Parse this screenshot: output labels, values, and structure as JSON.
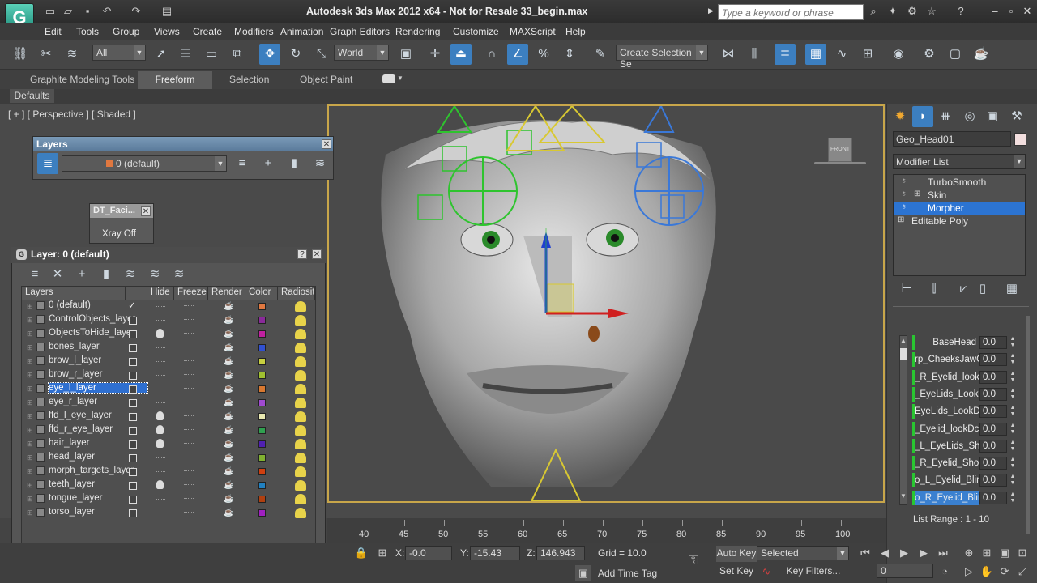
{
  "window": {
    "title": "Autodesk 3ds Max  2012 x64  - Not for Resale   33_begin.max",
    "search_placeholder": "Type a keyword or phrase",
    "logo_letter": "G"
  },
  "menu": [
    "Edit",
    "Tools",
    "Group",
    "Views",
    "Create",
    "Modifiers",
    "Animation",
    "Graph Editors",
    "Rendering",
    "Customize",
    "MAXScript",
    "Help"
  ],
  "toolbar": {
    "filter_value": "All",
    "coord_value": "World",
    "selection_set_placeholder": "Create Selection Se"
  },
  "ribbon": {
    "tabs": [
      "Graphite Modeling Tools",
      "Freeform",
      "Selection",
      "Object Paint"
    ],
    "active_tab": "Freeform",
    "defaults_label": "Defaults"
  },
  "viewport": {
    "label": "[ + ] [ Perspective ] [ Shaded ]",
    "viewcube_label": "FRONT"
  },
  "layers_toolbar": {
    "title": "Layers",
    "current_layer": "0 (default)"
  },
  "dt_facial": {
    "title": "DT_Faci...",
    "button": "Xray Off"
  },
  "layer_dialog": {
    "title": "Layer: 0 (default)",
    "columns": [
      "Layers",
      "Hide",
      "Freeze",
      "Render",
      "Color",
      "Radiosit"
    ],
    "rows": [
      {
        "name": "0 (default)",
        "current": true,
        "hide_bulb": false,
        "color": "#e07840"
      },
      {
        "name": "ControlObjects_layer",
        "current": false,
        "hide_bulb": false,
        "color": "#8a2a9a"
      },
      {
        "name": "ObjectsToHide_layer",
        "current": false,
        "hide_bulb": true,
        "color": "#c020a0"
      },
      {
        "name": "bones_layer",
        "current": false,
        "hide_bulb": false,
        "color": "#3050d0"
      },
      {
        "name": "brow_l_layer",
        "current": false,
        "hide_bulb": false,
        "color": "#c8d040"
      },
      {
        "name": "brow_r_layer",
        "current": false,
        "hide_bulb": false,
        "color": "#a0c030"
      },
      {
        "name": "eye_l_layer",
        "current": false,
        "hide_bulb": false,
        "color": "#d87830",
        "selected": true
      },
      {
        "name": "eye_r_layer",
        "current": false,
        "hide_bulb": false,
        "color": "#a04ad0"
      },
      {
        "name": "ffd_l_eye_layer",
        "current": false,
        "hide_bulb": true,
        "color": "#e8e8b0"
      },
      {
        "name": "ffd_r_eye_layer",
        "current": false,
        "hide_bulb": true,
        "color": "#30a050"
      },
      {
        "name": "hair_layer",
        "current": false,
        "hide_bulb": true,
        "color": "#5020b0"
      },
      {
        "name": "head_layer",
        "current": false,
        "hide_bulb": false,
        "color": "#80b030"
      },
      {
        "name": "morph_targets_layer",
        "current": false,
        "hide_bulb": false,
        "color": "#d04010"
      },
      {
        "name": "teeth_layer",
        "current": false,
        "hide_bulb": true,
        "color": "#2080c0"
      },
      {
        "name": "tongue_layer",
        "current": false,
        "hide_bulb": false,
        "color": "#b04010"
      },
      {
        "name": "torso_layer",
        "current": false,
        "hide_bulb": false,
        "color": "#a020c0"
      }
    ]
  },
  "command_panel": {
    "object_name": "Geo_Head01",
    "modifier_list": "Modifier List",
    "stack": [
      {
        "label": "TurboSmooth",
        "selected": false
      },
      {
        "label": "Skin",
        "selected": false
      },
      {
        "label": "Morpher",
        "selected": true
      },
      {
        "label": "Editable Poly",
        "selected": false
      }
    ],
    "channels": [
      {
        "name": "BaseHead",
        "value": "0.0"
      },
      {
        "name": "rp_CheeksJawOp",
        "value": "0.0"
      },
      {
        "name": "_R_Eyelid_lookd",
        "value": "0.0"
      },
      {
        "name": "_EyeLids_Look",
        "value": "0.0"
      },
      {
        "name": "EyeLids_LookD",
        "value": "0.0"
      },
      {
        "name": "_Eyelid_lookDc",
        "value": "0.0"
      },
      {
        "name": "_L_EyeLids_Sho",
        "value": "0.0"
      },
      {
        "name": "_R_Eyelid_Shoc",
        "value": "0.0"
      },
      {
        "name": "o_L_Eyelid_Blinl",
        "value": "0.0"
      },
      {
        "name": "o_R_Eyelid_Blin",
        "value": "0.0"
      }
    ],
    "list_range": "List Range :   1 - 10"
  },
  "timeline": {
    "ticks": [
      "40",
      "45",
      "50",
      "55",
      "60",
      "65",
      "70",
      "75",
      "80",
      "85",
      "90",
      "95",
      "100"
    ]
  },
  "status": {
    "x_label": "X:",
    "x_value": "-0.0",
    "y_label": "Y:",
    "y_value": "-15.43",
    "z_label": "Z:",
    "z_value": "146.943",
    "grid": "Grid = 10.0",
    "add_time_tag": "Add Time Tag",
    "auto_key": "Auto Key",
    "selected": "Selected",
    "set_key": "Set Key",
    "key_filters": "Key Filters...",
    "frame": "0"
  }
}
